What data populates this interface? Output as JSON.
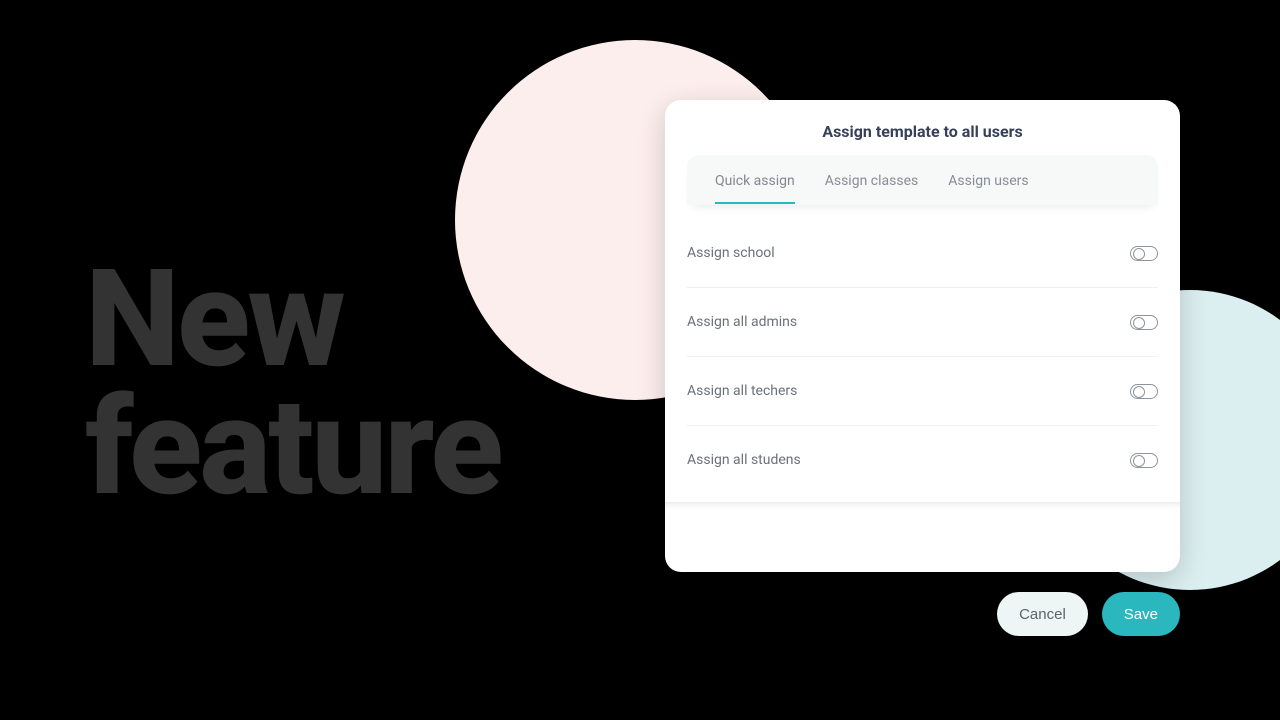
{
  "headline": {
    "line1": "New",
    "line2": "feature"
  },
  "card": {
    "title": "Assign template to all users",
    "tabs": [
      {
        "label": "Quick assign",
        "active": true
      },
      {
        "label": "Assign classes",
        "active": false
      },
      {
        "label": "Assign users",
        "active": false
      }
    ],
    "rows": [
      {
        "label": "Assign school",
        "on": false
      },
      {
        "label": "Assign all admins",
        "on": false
      },
      {
        "label": "Assign all techers",
        "on": false
      },
      {
        "label": "Assign all studens",
        "on": false
      }
    ]
  },
  "buttons": {
    "cancel": "Cancel",
    "save": "Save"
  },
  "colors": {
    "accent": "#2ab7bd",
    "pink": "#fdeeee",
    "blueCircle": "#dbeef0"
  }
}
